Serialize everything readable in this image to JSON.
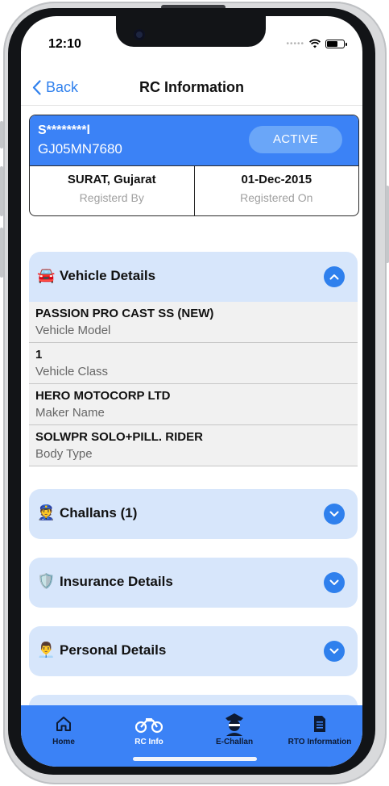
{
  "status": {
    "time": "12:10",
    "signal_dots": "•••••"
  },
  "navbar": {
    "back_label": "Back",
    "title": "RC Information"
  },
  "rc_card": {
    "masked_name": "S********l",
    "plate": "GJ05MN7680",
    "status": "ACTIVE",
    "registered_by_value": "SURAT, Gujarat",
    "registered_by_label": "Registerd By",
    "registered_on_value": "01-Dec-2015",
    "registered_on_label": "Registered On"
  },
  "sections": [
    {
      "emoji": "🚘",
      "title": "Vehicle Details",
      "expanded": true,
      "icon": "chevron-up-icon"
    },
    {
      "emoji": "👮",
      "title": "Challans (1)",
      "expanded": false,
      "icon": "chevron-down-icon"
    },
    {
      "emoji": "🛡️",
      "title": "Insurance Details",
      "expanded": false,
      "icon": "chevron-down-icon"
    },
    {
      "emoji": "👨‍💼",
      "title": "Personal Details",
      "expanded": false,
      "icon": "chevron-down-icon"
    }
  ],
  "vehicle_details": [
    {
      "value": "PASSION PRO CAST SS (NEW)",
      "label": "Vehicle Model"
    },
    {
      "value": "1",
      "label": "Vehicle Class"
    },
    {
      "value": "HERO MOTOCORP LTD",
      "label": "Maker Name"
    },
    {
      "value": "SOLWPR SOLO+PILL. RIDER",
      "label": "Body Type"
    }
  ],
  "tabbar": {
    "items": [
      {
        "label": "Home",
        "icon": "home-icon"
      },
      {
        "label": "RC Info",
        "icon": "motorcycle-icon"
      },
      {
        "label": "E-Challan",
        "icon": "police-officer-icon"
      },
      {
        "label": "RTO Information",
        "icon": "document-icon"
      }
    ]
  },
  "colors": {
    "accent": "#3b82f6",
    "section_bg": "#d7e6fb",
    "chevron": "#2f80ed",
    "active_pill": "#6aa6f8"
  }
}
